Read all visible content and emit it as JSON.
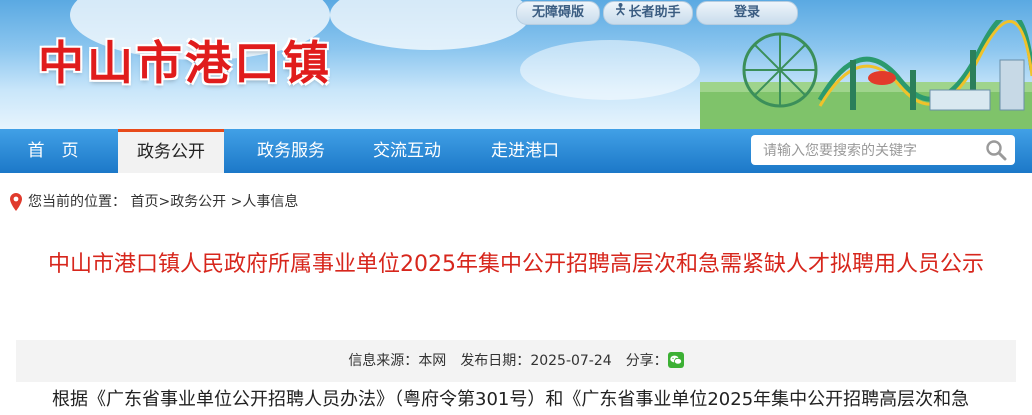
{
  "header": {
    "site_title": "中山市港口镇",
    "accessibility_label": "无障碍版",
    "elder_helper_label": "长者助手",
    "login_label": "登录"
  },
  "nav": {
    "items": [
      {
        "label": "首　页"
      },
      {
        "label": "政务公开",
        "active": true
      },
      {
        "label": "政务服务"
      },
      {
        "label": "交流互动"
      },
      {
        "label": "走进港口"
      }
    ],
    "search_placeholder": "请输入您要搜索的关键字"
  },
  "breadcrumb": {
    "prefix": "您当前的位置：",
    "items": [
      "首页",
      "政务公开",
      "人事信息"
    ],
    "separator": ">"
  },
  "article": {
    "title": "中山市港口镇人民政府所属事业单位2025年集中公开招聘高层次和急需紧缺人才拟聘用人员公示",
    "source_label": "信息来源：",
    "source_value": "本网",
    "date_label": "发布日期：",
    "date_value": "2025-07-24",
    "share_label": "分享：",
    "body_first_line": "根据《广东省事业单位公开招聘人员办法》（粤府令第301号）和《广东省事业单位2025年集中公开招聘高层次和急"
  },
  "colors": {
    "title_red": "#e01c1c",
    "nav_blue": "#1c78c8",
    "active_tab_accent": "#e84a1a",
    "article_title_red": "#d7261c"
  },
  "icons": {
    "elder_helper": "accessibility-person-icon",
    "search": "search-icon",
    "breadcrumb": "location-pin-icon",
    "share": "wechat-icon"
  }
}
